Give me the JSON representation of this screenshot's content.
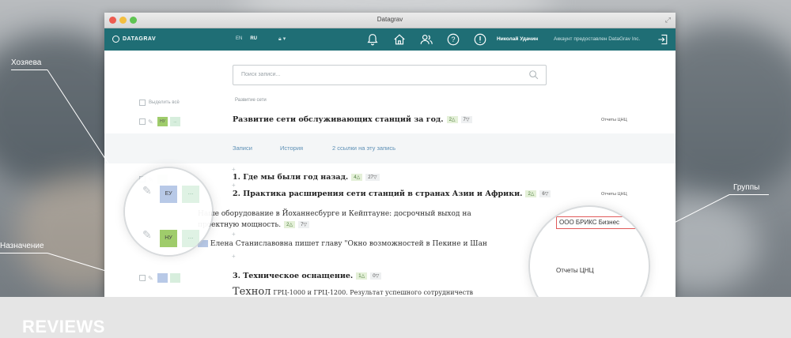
{
  "window": {
    "title": "Datagrav"
  },
  "appbar": {
    "logo": "DATAGRAV",
    "lang": [
      "EN",
      "RU"
    ],
    "lang_active": "RU",
    "username": "Николай Удачин",
    "account": "Аккаунт предоставлен DataGrav Inc."
  },
  "search": {
    "placeholder": "Поиск записи..."
  },
  "list": {
    "select_all": "Выделить всё",
    "section_label": "Развитие сети",
    "rows": [
      {
        "title": "Развитие сети обслуживающих станций за год.",
        "up": "2",
        "down": "7",
        "group": "Отчеты ЦНЦ",
        "tag": "НУ"
      },
      {
        "title": "1. Где мы были год назад.",
        "up": "4",
        "down": "27"
      },
      {
        "title": "2. Практика расширения сети станций в странах Азии и Африки.",
        "up": "2",
        "down": "6",
        "group": "Отчеты ЦНЦ"
      },
      {
        "title": "Наше оборудование в Йоханнесбурге и Кейптауне: досрочный выход на",
        "title2": "проектную мощность.",
        "up": "2",
        "down": "7"
      },
      {
        "title": "Елена Станиславовна пишет главу \"Окно возможностей в Пекине и Шан"
      },
      {
        "title": "3. Техническое оснащение.",
        "up": "1",
        "down": "0"
      },
      {
        "title": "Технол",
        "title_small": "ГРЦ-1000 и ГРЦ-1200. Результат успешного сотрудничеств"
      }
    ],
    "subtabs": [
      "Записи",
      "История",
      "2 ссылки на эту запись"
    ]
  },
  "magnifier": {
    "tag1": "ЕУ",
    "tag2": "НУ",
    "dots": "...",
    "group_edit": "ООО БРИКС Бизнес",
    "group_reports": "Отчеты ЦНЦ"
  },
  "callouts": {
    "owners": "Хозяева",
    "assignment": "Назначение",
    "groups": "Группы"
  },
  "footer": {
    "title": "REVIEWS"
  }
}
